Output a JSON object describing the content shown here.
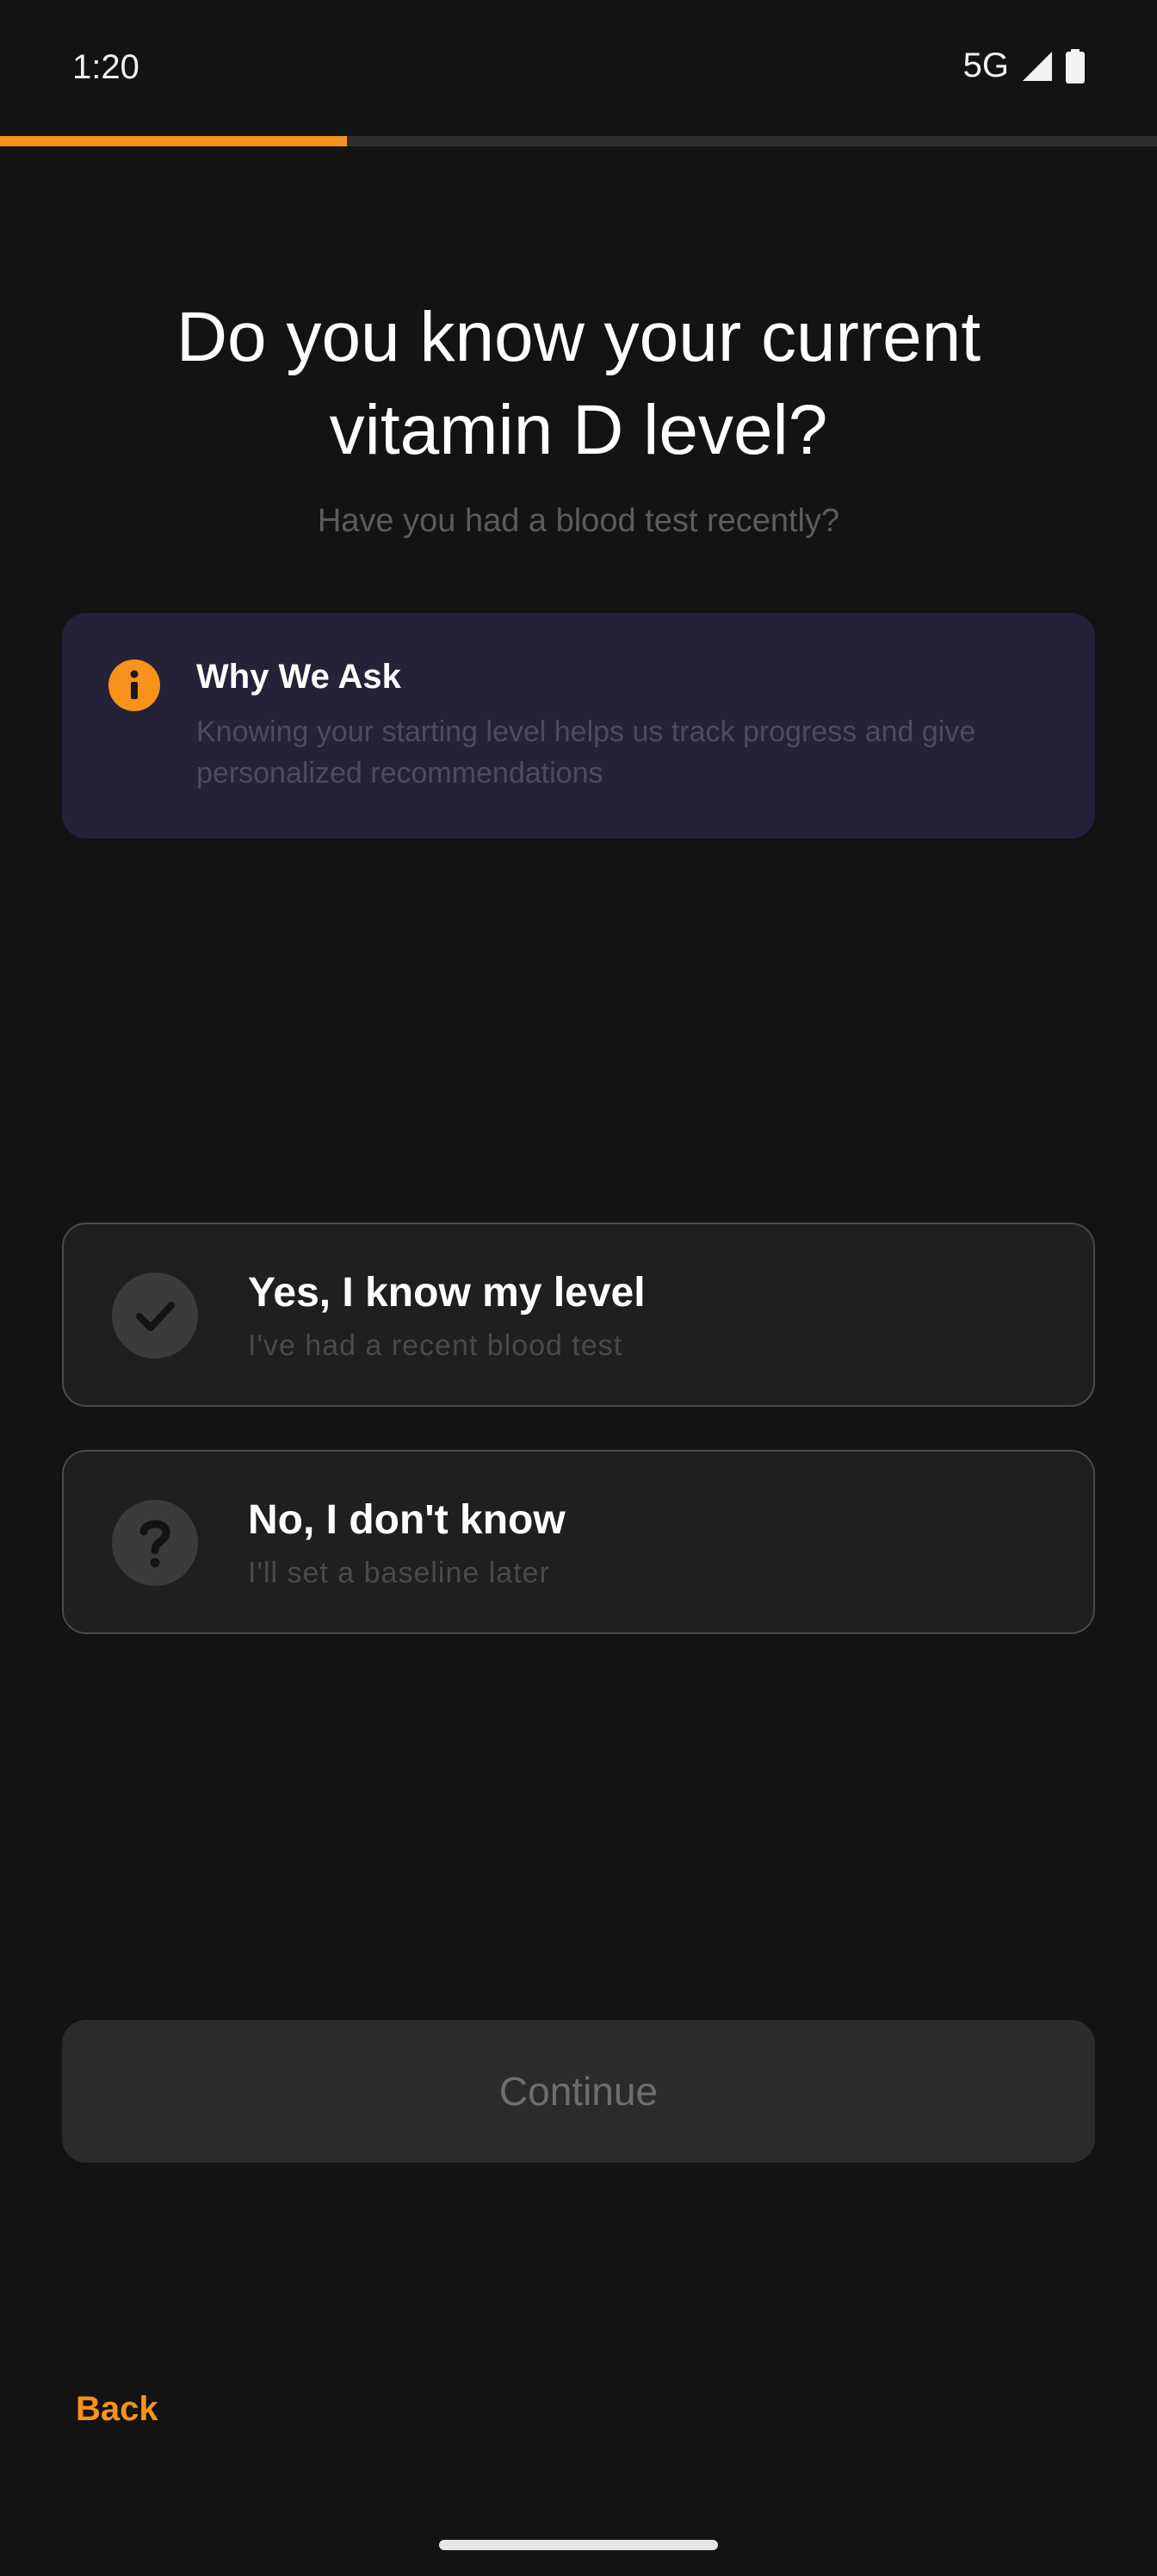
{
  "status_bar": {
    "time": "1:20",
    "network": "5G",
    "icons": [
      "signal-icon",
      "battery-icon"
    ]
  },
  "progress": {
    "fraction": 0.3
  },
  "heading": {
    "title": "Do you know your current vitamin D level?",
    "subtitle": "Have you had a blood test recently?"
  },
  "info_card": {
    "icon": "info-icon",
    "title": "Why We Ask",
    "text": "Knowing your starting level helps us track progress and give personalized recommendations"
  },
  "options": [
    {
      "icon": "checkmark-icon",
      "title": "Yes, I know my level",
      "subtitle": "I've had a recent blood test"
    },
    {
      "icon": "question-mark-icon",
      "title": "No, I don't know",
      "subtitle": "I'll set a baseline later"
    }
  ],
  "actions": {
    "continue_label": "Continue",
    "back_label": "Back"
  },
  "colors": {
    "accent": "#f7931a",
    "background": "#131313",
    "info_card_bg": "#252138",
    "option_bg": "#1f1f1f"
  }
}
